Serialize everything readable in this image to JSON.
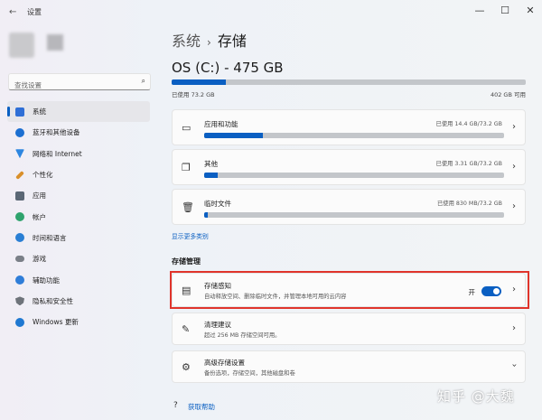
{
  "window": {
    "title": "设置",
    "controls": {
      "minimize": "—",
      "maximize": "☐",
      "close": "✕"
    }
  },
  "search": {
    "placeholder": "查找设置",
    "icon": "search-icon"
  },
  "sidebar": {
    "items": [
      {
        "label": "系统",
        "active": true,
        "icon": "display-icon",
        "color": "#2f6fd6"
      },
      {
        "label": "蓝牙和其他设备",
        "icon": "bluetooth-icon",
        "color": "#1c6fd1"
      },
      {
        "label": "网络和 Internet",
        "icon": "wifi-icon",
        "color": "#2d86e0"
      },
      {
        "label": "个性化",
        "icon": "brush-icon",
        "color": "#d98f2a"
      },
      {
        "label": "应用",
        "icon": "apps-icon",
        "color": "#5b6775"
      },
      {
        "label": "帐户",
        "icon": "account-icon",
        "color": "#2fa36d"
      },
      {
        "label": "时间和语言",
        "icon": "globe-clock-icon",
        "color": "#2a7fd4"
      },
      {
        "label": "游戏",
        "icon": "gamepad-icon",
        "color": "#7a7f87"
      },
      {
        "label": "辅助功能",
        "icon": "accessibility-icon",
        "color": "#2f7dd8"
      },
      {
        "label": "隐私和安全性",
        "icon": "shield-icon",
        "color": "#6e737a"
      },
      {
        "label": "Windows 更新",
        "icon": "update-icon",
        "color": "#1f78d1"
      }
    ]
  },
  "header": {
    "parent": "系统",
    "separator": "›",
    "current": "存储"
  },
  "drive": {
    "name": "OS (C:) - 475 GB",
    "used_label": "已使用 73.2 GB",
    "total_label": "402 GB 可用",
    "used_fraction": 0.154
  },
  "categories": [
    {
      "title": "应用和功能",
      "usage": "已使用 14.4 GB/73.2 GB",
      "fraction": 0.197,
      "icon": "apps-features-icon"
    },
    {
      "title": "其他",
      "usage": "已使用 3.31 GB/73.2 GB",
      "fraction": 0.045,
      "icon": "folder-icon"
    },
    {
      "title": "临时文件",
      "usage": "已使用 830 MB/73.2 GB",
      "fraction": 0.011,
      "icon": "trash-icon"
    }
  ],
  "more_link": "显示更多类别",
  "management": {
    "section_title": "存储管理",
    "storage_sense": {
      "title": "存储感知",
      "subtitle": "自动释放空间、删除临时文件，并管理本地可用的云内容",
      "toggle_label": "开",
      "toggle_on": true,
      "icon": "storage-sense-icon"
    },
    "cleanup": {
      "title": "清理建议",
      "subtitle": "超过 256 MB 存储空间可用。",
      "icon": "broom-icon"
    },
    "advanced": {
      "title": "高级存储设置",
      "subtitle": "备份选项，存储空间，其他磁盘和卷",
      "icon": "gear-icon"
    }
  },
  "help": {
    "label": "获取帮助",
    "icon": "help-icon"
  },
  "watermark": "知乎 @大魏"
}
